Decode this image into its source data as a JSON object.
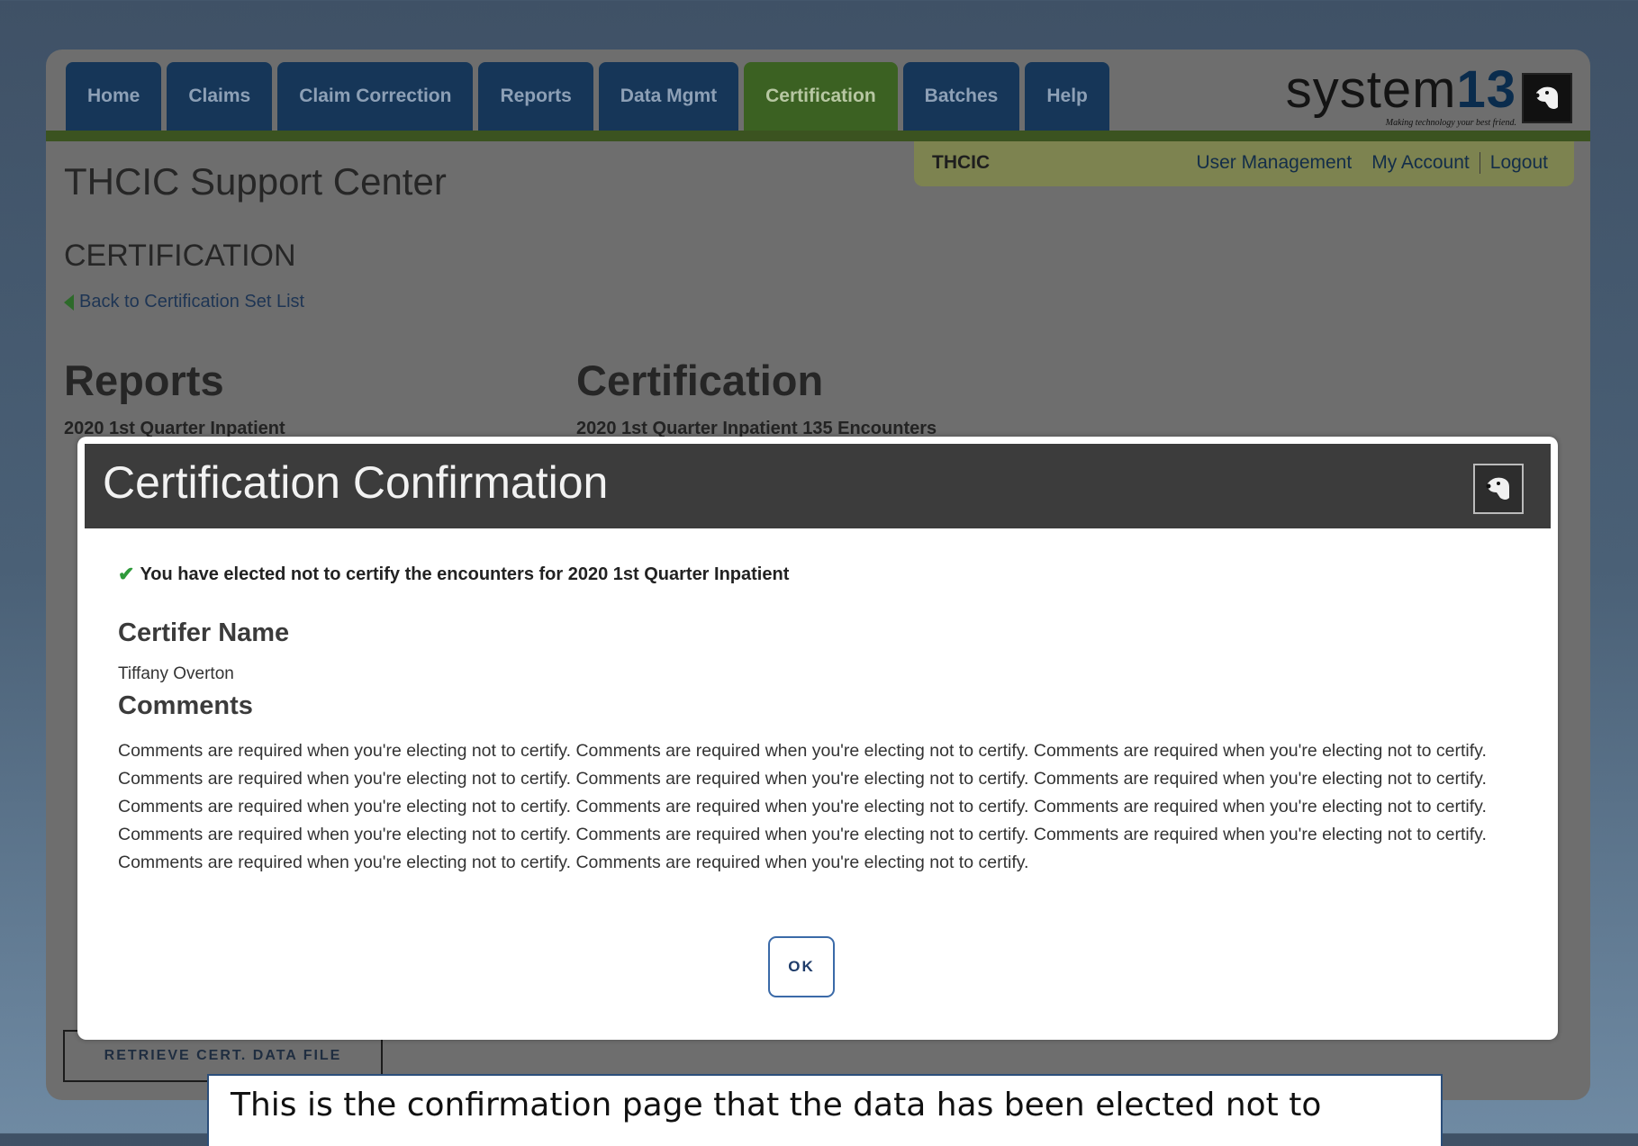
{
  "nav": {
    "tabs": [
      "Home",
      "Claims",
      "Claim Correction",
      "Reports",
      "Data Mgmt",
      "Certification",
      "Batches",
      "Help"
    ],
    "active_tab": "Certification"
  },
  "logo": {
    "text": "system",
    "number": "13",
    "tagline": "Making technology your best friend."
  },
  "utility": {
    "org": "THCIC",
    "user_management": "User Management",
    "my_account": "My Account",
    "logout": "Logout"
  },
  "page": {
    "title": "THCIC Support Center",
    "section": "CERTIFICATION",
    "back_link": "Back to Certification Set List",
    "reports_heading": "Reports",
    "certification_heading": "Certification",
    "reports_subtitle": "2020 1st Quarter Inpatient",
    "certification_subtitle": "2020 1st Quarter Inpatient 135 Encounters",
    "retrieve_button": "RETRIEVE CERT. DATA FILE"
  },
  "modal": {
    "title": "Certification Confirmation",
    "message": "You have elected not to certify the encounters for 2020 1st Quarter Inpatient",
    "certifier_label": "Certifer Name",
    "certifier_value": "Tiffany Overton",
    "comments_label": "Comments",
    "comments_value": "Comments are required when you're electing not to certify. Comments are required when you're electing not to certify. Comments are required when you're electing not to certify. Comments are required when you're electing not to certify. Comments are required when you're electing not to certify. Comments are required when you're electing not to certify. Comments are required when you're electing not to certify. Comments are required when you're electing not to certify. Comments are required when you're electing not to certify. Comments are required when you're electing not to certify. Comments are required when you're electing not to certify. Comments are required when you're electing not to certify. Comments are required when you're electing not to certify. Comments are required when you're electing not to certify.",
    "ok_button": "OK"
  },
  "caption": "This is the confirmation page that the data has been elected not to",
  "colors": {
    "nav_tab": "#163658",
    "nav_active": "#3b6122",
    "modal_header": "#3c3c3c",
    "check": "#2e9a3a",
    "ok_border": "#3b6aa8"
  }
}
